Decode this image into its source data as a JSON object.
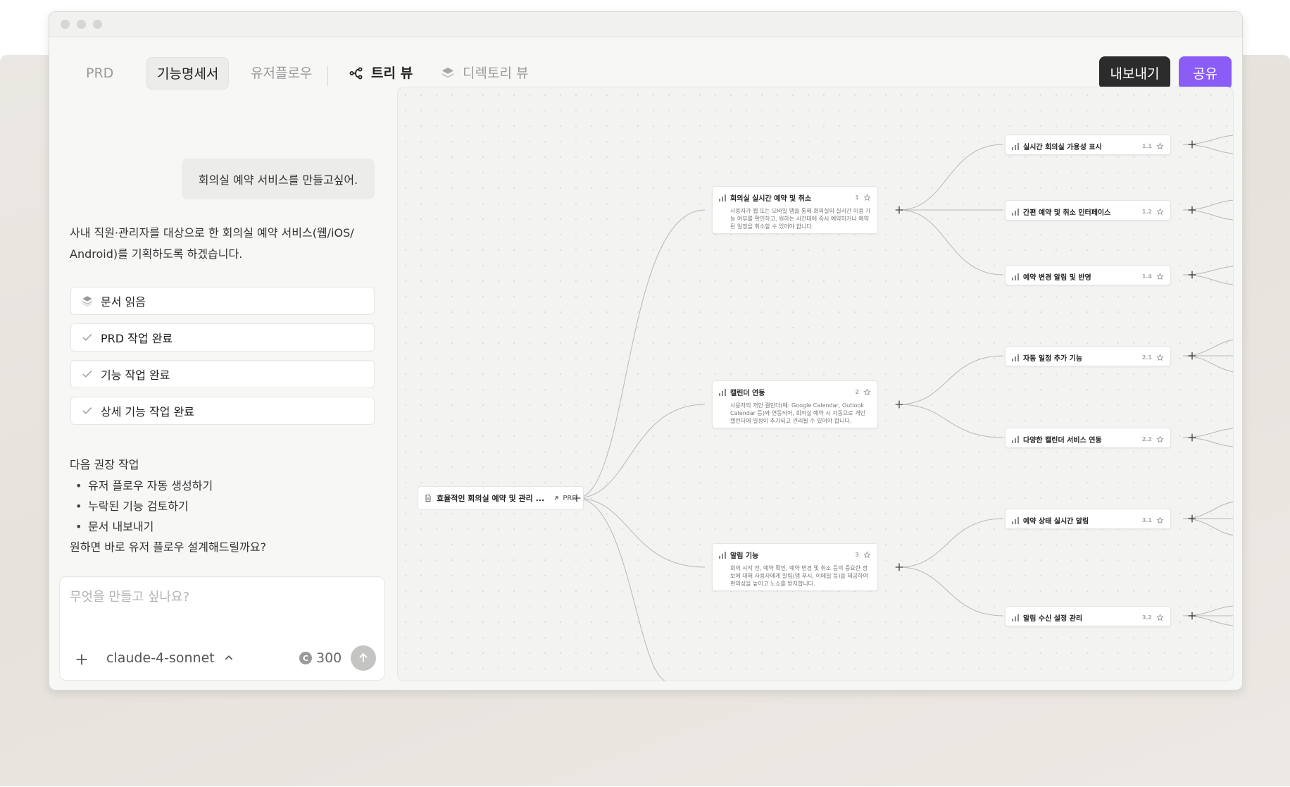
{
  "toolbar": {
    "tabs": [
      {
        "label": "PRD"
      },
      {
        "label": "기능명세서"
      },
      {
        "label": "유저플로우"
      }
    ],
    "views": [
      {
        "label": "트리 뷰"
      },
      {
        "label": "디렉토리 뷰"
      }
    ],
    "export_label": "내보내기",
    "share_label": "공유"
  },
  "chat": {
    "user_message": "회의실 예약 서비스를 만들고싶어.",
    "assistant_intro_line1": "사내 직원·관리자를 대상으로 한 회의실 예약 서비스(웹/iOS/",
    "assistant_intro_line2": "Android)를 기획하도록 하겠습니다.",
    "status_items": [
      {
        "label": "문서 읽음",
        "icon": "layers-icon"
      },
      {
        "label": "PRD 작업 완료",
        "icon": "check-icon"
      },
      {
        "label": "기능 작업 완료",
        "icon": "check-icon"
      },
      {
        "label": "상세 기능 작업 완료",
        "icon": "check-icon"
      }
    ],
    "recommendation_title": "다음 권장 작업",
    "recommendations": [
      "유저 플로우 자동 생성하기",
      "누락된 기능 검토하기",
      "문서 내보내기"
    ],
    "followup_question": "원하면 바로 유저 플로우 설계해드릴까요?"
  },
  "composer": {
    "placeholder": "무엇을 만들고 싶나요?",
    "model": "claude-4-sonnet",
    "credits": "300"
  },
  "tree": {
    "root": {
      "title": "효율적인 회의실 예약 및 관리 ...",
      "link_label": "PRD"
    },
    "features": [
      {
        "title": "회의실 실시간 예약 및 취소",
        "num": "1",
        "desc": "사용자가 웹 또는 모바일 앱을 통해 회의실의 실시간 이용 가능 여부를 확인하고, 원하는 시간대에 즉시 예약하거나 예약된 일정을 취소할 수 있어야 합니다."
      },
      {
        "title": "캘린더 연동",
        "num": "2",
        "desc": "사용자의 개인 캘린더(예: Google Calendar, Outlook Calendar 등)와 연동되어, 회의실 예약 시 자동으로 개인 캘린더에 일정이 추가되고 관리될 수 있어야 합니다."
      },
      {
        "title": "알림 기능",
        "num": "3",
        "desc": "회의 시작 전, 예약 확인, 예약 변경 및 취소 등의 중요한 정보에 대해 사용자에게 알림(앱 푸시, 이메일 등)을 제공하여 편의성을 높이고 노쇼를 방지합니다."
      }
    ],
    "details": [
      {
        "title": "실시간 회의실 가용성 표시",
        "num": "1.1"
      },
      {
        "title": "간편 예약 및 취소 인터페이스",
        "num": "1.2"
      },
      {
        "title": "예약 변경 알림 및 반영",
        "num": "1.4"
      },
      {
        "title": "자동 일정 추가 기능",
        "num": "2.1"
      },
      {
        "title": "다양한 캘린더 서비스 연동",
        "num": "2.2"
      },
      {
        "title": "예약 상태 실시간 알림",
        "num": "3.1"
      },
      {
        "title": "알림 수신 설정 관리",
        "num": "3.2"
      }
    ]
  }
}
